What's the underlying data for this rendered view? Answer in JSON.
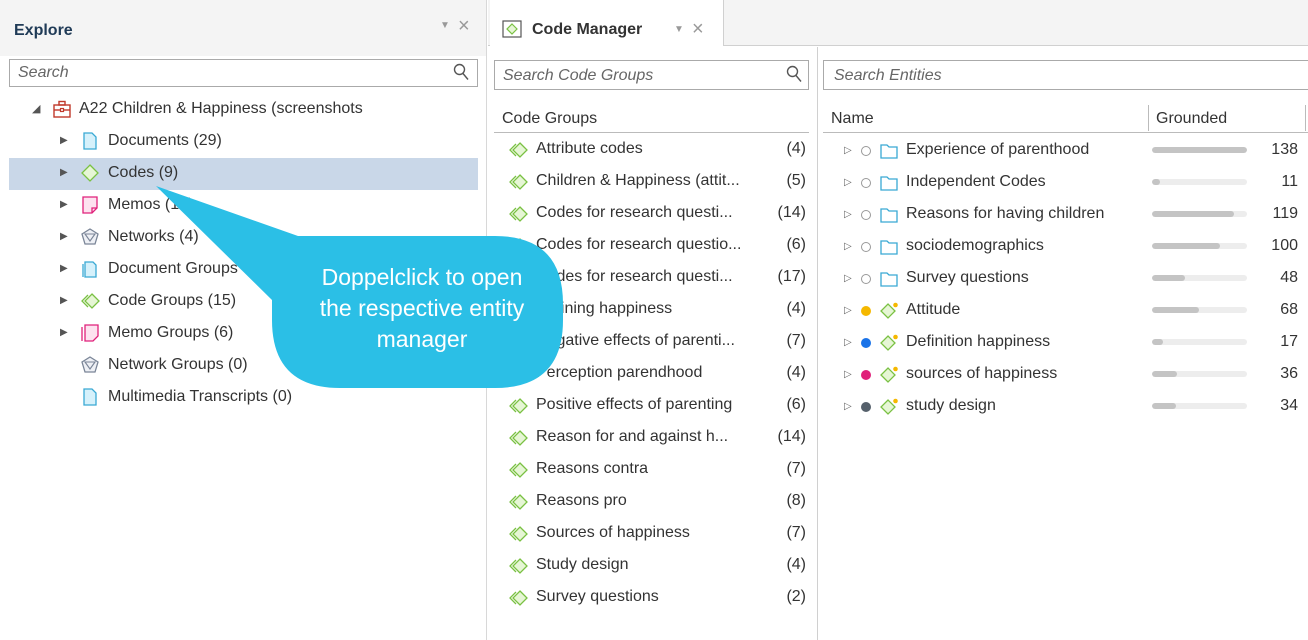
{
  "explore": {
    "title": "Explore",
    "search_placeholder": "Search",
    "project": "A22 Children & Happiness (screenshots",
    "items": [
      {
        "label": "Documents (29)",
        "icon": "document-icon"
      },
      {
        "label": "Codes (9)",
        "icon": "code-icon"
      },
      {
        "label": "Memos (15)",
        "icon": "memo-icon"
      },
      {
        "label": "Networks (4)",
        "icon": "network-icon"
      },
      {
        "label": "Document Groups",
        "icon": "document-group-icon"
      },
      {
        "label": "Code Groups (15)",
        "icon": "code-group-icon"
      },
      {
        "label": "Memo Groups (6)",
        "icon": "memo-group-icon"
      },
      {
        "label": "Network Groups (0)",
        "icon": "network-group-icon"
      },
      {
        "label": "Multimedia Transcripts (0)",
        "icon": "transcript-icon"
      }
    ]
  },
  "code_manager": {
    "tab_label": "Code Manager",
    "groups_search_placeholder": "Search Code Groups",
    "groups_header": "Code Groups",
    "groups": [
      {
        "label": "Attribute codes",
        "count": "(4)"
      },
      {
        "label": "Children & Happiness (attit...",
        "count": "(5)"
      },
      {
        "label": "Codes for research questi...",
        "count": "(14)"
      },
      {
        "label": "Codes for research questio...",
        "count": "(6)"
      },
      {
        "label": "Codes for research questi...",
        "count": "(17)"
      },
      {
        "label": "Defining happiness",
        "count": "(4)"
      },
      {
        "label": "Negative effects of parenti...",
        "count": "(7)"
      },
      {
        "label": "Perception parendhood",
        "count": "(4)"
      },
      {
        "label": "Positive effects of parenting",
        "count": "(6)"
      },
      {
        "label": "Reason for and against h...",
        "count": "(14)"
      },
      {
        "label": "Reasons contra",
        "count": "(7)"
      },
      {
        "label": "Reasons pro",
        "count": "(8)"
      },
      {
        "label": "Sources of happiness",
        "count": "(7)"
      },
      {
        "label": "Study design",
        "count": "(4)"
      },
      {
        "label": "Survey questions",
        "count": "(2)"
      }
    ],
    "entities_search_placeholder": "Search Entities",
    "col_name": "Name",
    "col_grounded": "Grounded",
    "entities": [
      {
        "label": "Experience of parenthood",
        "grounded": "138",
        "fill": 1.0,
        "type": "folder",
        "color": ""
      },
      {
        "label": "Independent Codes",
        "grounded": "11",
        "fill": 0.08,
        "type": "folder",
        "color": ""
      },
      {
        "label": "Reasons for having children",
        "grounded": "119",
        "fill": 0.86,
        "type": "folder",
        "color": ""
      },
      {
        "label": "sociodemographics",
        "grounded": "100",
        "fill": 0.72,
        "type": "folder",
        "color": ""
      },
      {
        "label": "Survey questions",
        "grounded": "48",
        "fill": 0.35,
        "type": "folder",
        "color": ""
      },
      {
        "label": "Attitude",
        "grounded": "68",
        "fill": 0.49,
        "type": "code",
        "color": "#f5b800"
      },
      {
        "label": "Definition happiness",
        "grounded": "17",
        "fill": 0.12,
        "type": "code",
        "color": "#1a73e8"
      },
      {
        "label": "sources of happiness",
        "grounded": "36",
        "fill": 0.26,
        "type": "code",
        "color": "#e0207a"
      },
      {
        "label": "study design",
        "grounded": "34",
        "fill": 0.25,
        "type": "code",
        "color": "#55606b"
      }
    ]
  },
  "callout": {
    "line1": "Doppelclick to open",
    "line2": "the respective entity",
    "line3": "manager",
    "color": "#2bbfe6"
  }
}
